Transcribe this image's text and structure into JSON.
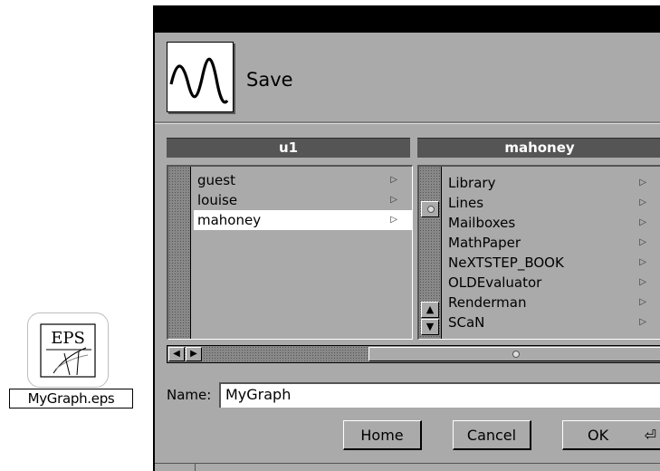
{
  "desktop_icon": {
    "badge_text": "EPS",
    "file_name": "MyGraph.eps"
  },
  "panel": {
    "title": "Save",
    "logo_icon": "waveform-icon"
  },
  "browser": {
    "column_1": {
      "header": "u1",
      "items": [
        {
          "label": "guest",
          "branch": true,
          "selected": false
        },
        {
          "label": "louise",
          "branch": true,
          "selected": false
        },
        {
          "label": "mahoney",
          "branch": true,
          "selected": true
        }
      ]
    },
    "column_2": {
      "header": "mahoney",
      "items": [
        {
          "label": "Library",
          "branch": true
        },
        {
          "label": "Lines",
          "branch": true
        },
        {
          "label": "Mailboxes",
          "branch": true
        },
        {
          "label": "MathPaper",
          "branch": true
        },
        {
          "label": "NeXTSTEP_BOOK",
          "branch": true
        },
        {
          "label": "OLDEvaluator",
          "branch": true
        },
        {
          "label": "Renderman",
          "branch": true
        },
        {
          "label": "SCaN",
          "branch": true
        }
      ]
    }
  },
  "name_field": {
    "label": "Name:",
    "value": "MyGraph"
  },
  "buttons": {
    "home": "Home",
    "cancel": "Cancel",
    "ok": "OK"
  },
  "colors": {
    "panel_gray": "#aaaaaa",
    "header_dark": "#555555",
    "titlebar": "#000000"
  }
}
